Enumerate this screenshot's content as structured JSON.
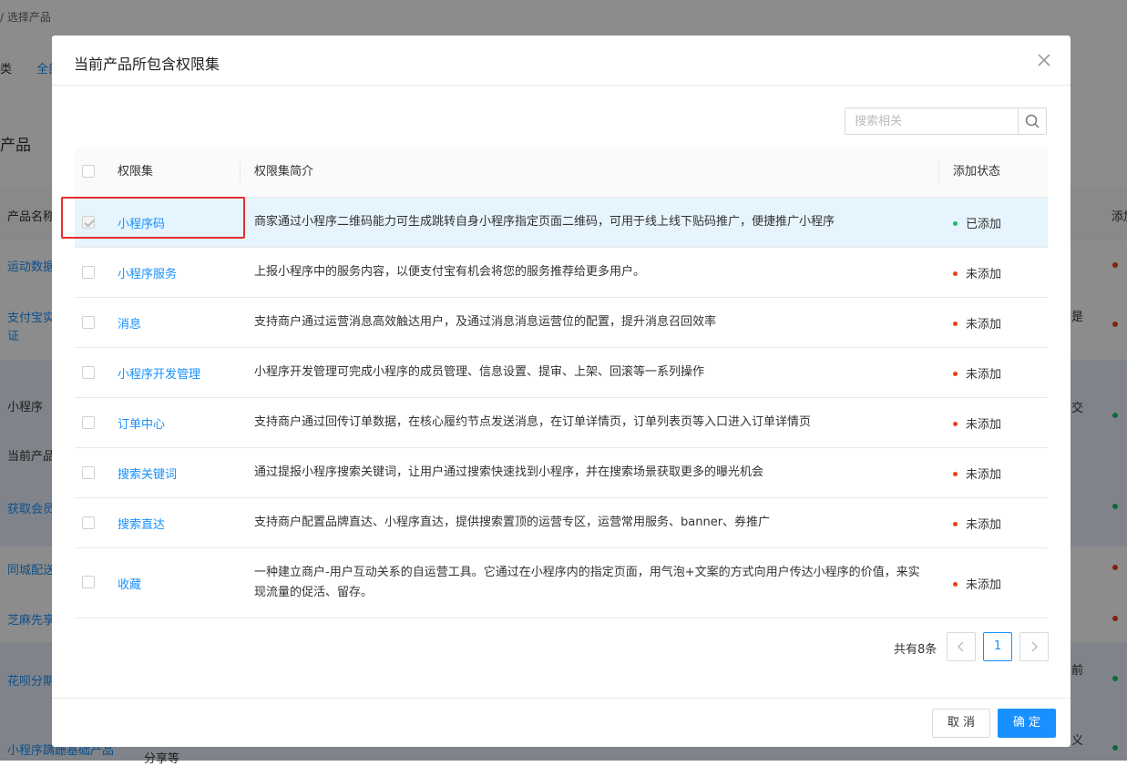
{
  "background": {
    "breadcrumb": "/  选择产品",
    "category_label": "类",
    "category_link": "全部",
    "section_title": "产品",
    "table_header_name": "产品名称",
    "table_header_status": "添加",
    "rows": [
      "运动数据",
      "支付宝实名认",
      "证",
      "小程序",
      "当前产品",
      "获取会员",
      "同城配送",
      "芝麻先享",
      "花呗分期",
      "小程序蹒跚基础产品",
      "分享等"
    ],
    "right_fragments": [
      "是",
      "交",
      "前",
      "义"
    ]
  },
  "modal": {
    "title": "当前产品所包含权限集",
    "search_placeholder": "搜索相关",
    "columns": {
      "name": "权限集",
      "desc": "权限集简介",
      "status": "添加状态"
    },
    "rows": [
      {
        "name": "小程序码",
        "desc": "商家通过小程序二维码能力可生成跳转自身小程序指定页面二维码，可用于线上线下贴码推广，便捷推广小程序",
        "status": "已添加",
        "checked": true
      },
      {
        "name": "小程序服务",
        "desc": "上报小程序中的服务内容，以便支付宝有机会将您的服务推荐给更多用户。",
        "status": "未添加",
        "checked": false
      },
      {
        "name": "消息",
        "desc": "支持商户通过运营消息高效触达用户，及通过消息消息运营位的配置，提升消息召回效率",
        "status": "未添加",
        "checked": false
      },
      {
        "name": "小程序开发管理",
        "desc": "小程序开发管理可完成小程序的成员管理、信息设置、提审、上架、回滚等一系列操作",
        "status": "未添加",
        "checked": false
      },
      {
        "name": "订单中心",
        "desc": "支持商户通过回传订单数据，在核心履约节点发送消息，在订单详情页，订单列表页等入口进入订单详情页",
        "status": "未添加",
        "checked": false
      },
      {
        "name": "搜索关键词",
        "desc": "通过提报小程序搜索关键词，让用户通过搜索快速找到小程序，并在搜索场景获取更多的曝光机会",
        "status": "未添加",
        "checked": false
      },
      {
        "name": "搜索直达",
        "desc": "支持商户配置品牌直达、小程序直达，提供搜索置顶的运营专区，运营常用服务、banner、券推广",
        "status": "未添加",
        "checked": false
      },
      {
        "name": "收藏",
        "desc": "一种建立商户-用户互动关系的自运营工具。它通过在小程序内的指定页面，用气泡+文案的方式向用户传达小程序的价值，来实现流量的促活、留存。",
        "status": "未添加",
        "checked": false
      }
    ],
    "pagination": {
      "total": "共有8条",
      "current": "1"
    },
    "buttons": {
      "cancel": "取 消",
      "ok": "确 定"
    }
  },
  "colors": {
    "added": "#19be6b",
    "not_added": "#ed3f14",
    "accent": "#1890ff",
    "highlight_box": "#e62e2e"
  }
}
